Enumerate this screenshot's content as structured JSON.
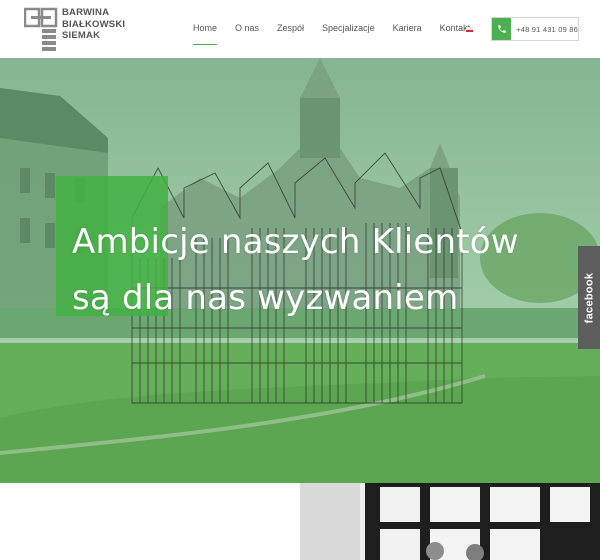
{
  "header": {
    "logo": {
      "lines": [
        "BARWINA",
        "BIAŁKOWSKI",
        "SIEMAK"
      ]
    },
    "nav": [
      {
        "label": "Home",
        "active": true
      },
      {
        "label": "O nas",
        "active": false
      },
      {
        "label": "Zespół",
        "active": false
      },
      {
        "label": "Specjalizacje",
        "active": false
      },
      {
        "label": "Kariera",
        "active": false
      },
      {
        "label": "Kontakt",
        "active": false
      }
    ],
    "language_flag": "flag-pl-icon",
    "phone": {
      "icon": "phone-icon",
      "number": "+48 91 431 09 86"
    }
  },
  "hero": {
    "title_line_1": "Ambicje naszych Klientów",
    "title_line_2": "są dla nas wyzwaniem",
    "overlay_color": "#4caf50"
  },
  "social_tab": {
    "label": "facebook"
  },
  "colors": {
    "accent": "#4caf50",
    "nav_text": "#555555",
    "social_tab": "#5d5d5d"
  }
}
